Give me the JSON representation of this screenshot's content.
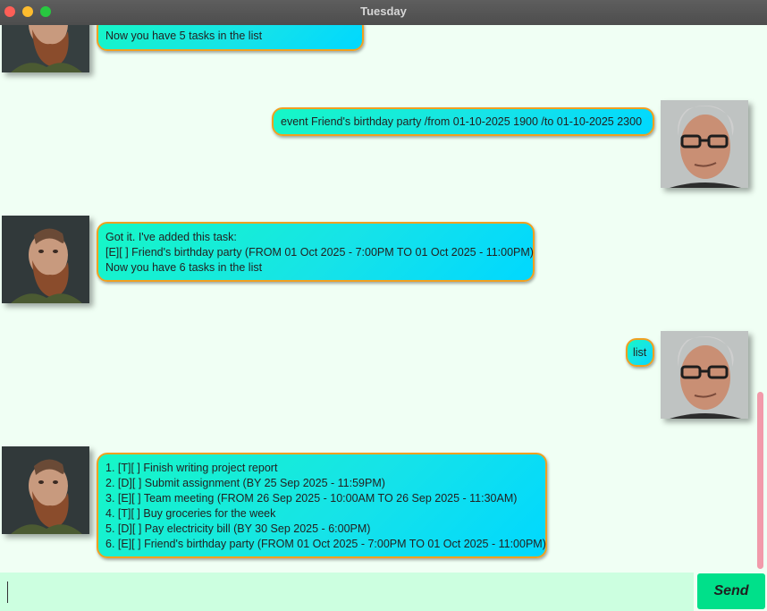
{
  "window": {
    "title": "Tuesday"
  },
  "messages": {
    "m0": {
      "lines": [
        "Now you have 5 tasks in the list"
      ]
    },
    "m1": {
      "lines": [
        "event Friend's birthday party /from 01-10-2025 1900 /to 01-10-2025 2300"
      ]
    },
    "m2": {
      "lines": [
        "Got it. I've added this task:",
        "[E][ ] Friend's birthday party (FROM 01 Oct 2025 - 7:00PM TO 01 Oct 2025 - 11:00PM)",
        "Now you have 6 tasks in the list"
      ]
    },
    "m3": {
      "lines": [
        "list"
      ]
    },
    "m4": {
      "lines": [
        "1. [T][ ] Finish writing project report",
        "2. [D][ ] Submit assignment (BY 25 Sep 2025 - 11:59PM)",
        "3. [E][ ] Team meeting (FROM 26 Sep 2025 - 10:00AM TO 26 Sep 2025 - 11:30AM)",
        "4. [T][ ] Buy groceries for the week",
        "5. [D][ ] Pay electricity bill (BY 30 Sep 2025 - 6:00PM)",
        "6. [E][ ] Friend's birthday party (FROM 01 Oct 2025 - 7:00PM TO 01 Oct 2025 - 11:00PM)"
      ]
    }
  },
  "input": {
    "value": "",
    "placeholder": ""
  },
  "send_button": {
    "label": "Send"
  },
  "colors": {
    "bubble_gradient_start": "#16f7c6",
    "bubble_gradient_end": "#00d8ff",
    "bubble_border": "#f0a020",
    "background": "#f0fff4",
    "input_background": "#ccffe0",
    "send_background": "#00e08a",
    "scrollbar_thumb": "#f29aaa"
  },
  "icons": {
    "bot_avatar": "bearded-man-avatar-icon",
    "user_avatar": "man-with-glasses-avatar-icon"
  }
}
